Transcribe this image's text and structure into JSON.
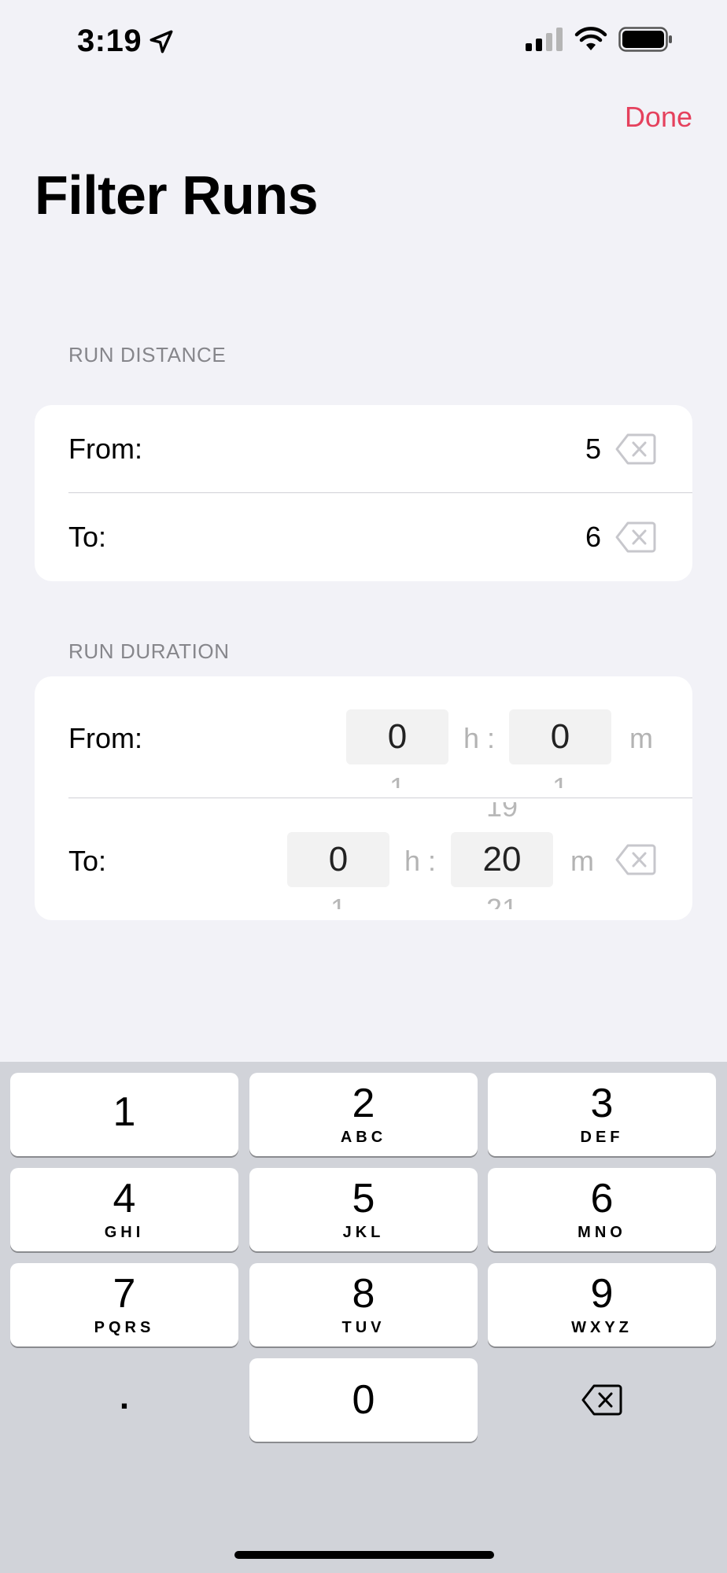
{
  "status_bar": {
    "time": "3:19",
    "icons": [
      "location-arrow-icon",
      "cellular-signal-icon",
      "wifi-icon",
      "battery-icon"
    ]
  },
  "nav": {
    "done_label": "Done"
  },
  "page_title": "Filter Runs",
  "run_distance": {
    "header": "RUN DISTANCE",
    "from_label": "From:",
    "from_value": "5",
    "to_label": "To:",
    "to_value": "6"
  },
  "run_duration": {
    "header": "RUN DURATION",
    "from_label": "From:",
    "from_hours": "0",
    "from_hours_next": "1",
    "from_minutes": "0",
    "from_minutes_next": "1",
    "to_label": "To:",
    "to_hours": "0",
    "to_hours_next": "1",
    "to_minutes_prev": "19",
    "to_minutes": "20",
    "to_minutes_next": "21",
    "hours_unit": "h :",
    "minutes_unit": "m"
  },
  "keypad": {
    "keys": [
      {
        "num": "1",
        "letters": ""
      },
      {
        "num": "2",
        "letters": "ABC"
      },
      {
        "num": "3",
        "letters": "DEF"
      },
      {
        "num": "4",
        "letters": "GHI"
      },
      {
        "num": "5",
        "letters": "JKL"
      },
      {
        "num": "6",
        "letters": "MNO"
      },
      {
        "num": "7",
        "letters": "PQRS"
      },
      {
        "num": "8",
        "letters": "TUV"
      },
      {
        "num": "9",
        "letters": "WXYZ"
      },
      {
        "num": "0",
        "letters": ""
      }
    ],
    "decimal": "."
  },
  "colors": {
    "accent": "#e5415d",
    "background": "#f2f2f7",
    "keyboard": "#d1d3d9"
  }
}
